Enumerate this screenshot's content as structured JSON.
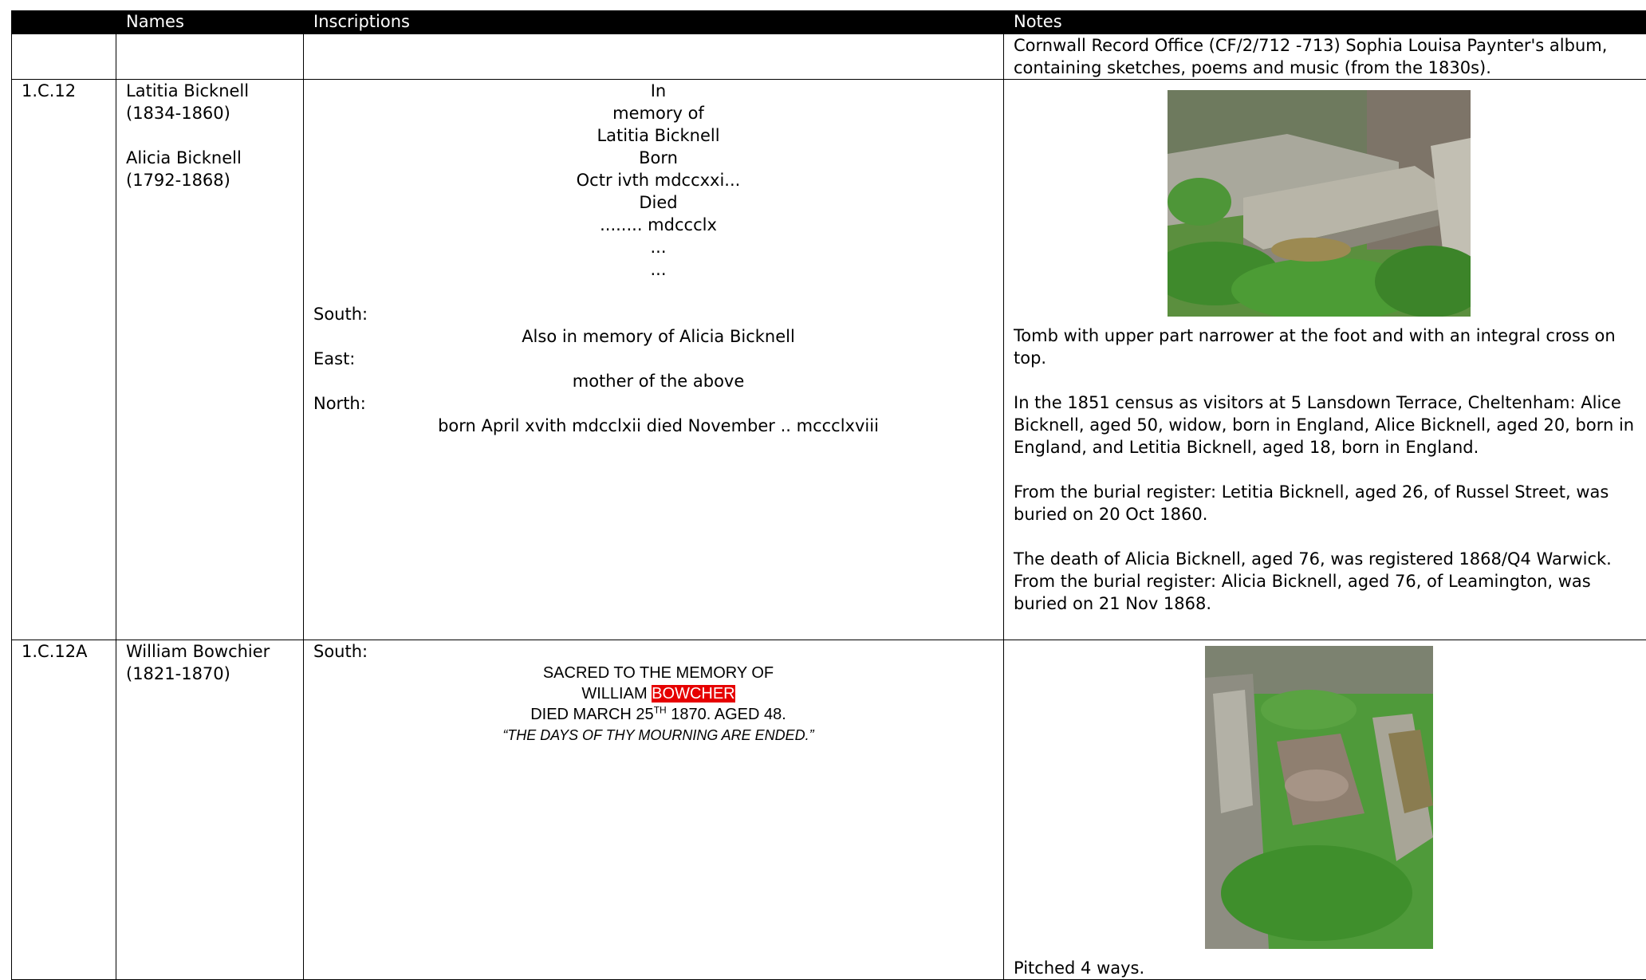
{
  "headers": [
    "",
    "Names",
    "Inscriptions",
    "Notes"
  ],
  "row0": {
    "note": "Cornwall Record Office (CF/2/712 -713) Sophia Louisa Paynter's album, containing sketches, poems and music (from the 1830s)."
  },
  "row1": {
    "id": "1.C.12",
    "name1": "Latitia Bicknell",
    "dates1": "(1834-1860)",
    "name2": "Alicia Bicknell",
    "dates2": "(1792-1868)",
    "inscription_lines": [
      "In",
      "memory of",
      "Latitia Bicknell",
      "Born",
      "Octr ivth mdccxxi...",
      "Died",
      "........ mdccclx",
      "...",
      "..."
    ],
    "south_label": "South:",
    "south_text": "Also in memory of Alicia Bicknell",
    "east_label": "East:",
    "east_text": "mother of the above",
    "north_label": "North:",
    "north_text": "born April xvith mdcclxii died November .. mccclxviii",
    "notes": [
      "Tomb with upper part narrower at the foot and with an integral cross on top.",
      "In the 1851 census as visitors at 5 Lansdown Terrace, Cheltenham: Alice Bicknell, aged 50, widow, born in England, Alice Bicknell, aged 20, born in England, and Letitia Bicknell, aged 18, born in England.",
      "From the burial register: Letitia Bicknell, aged 26, of Russel Street, was buried on 20 Oct 1860.",
      "The death of Alicia Bicknell, aged 76, was registered 1868/Q4 Warwick. From the burial register: Alicia Bicknell, aged 76, of Leamington, was buried on 21 Nov 1868."
    ]
  },
  "row2": {
    "id": "1.C.12A",
    "name": "William Bowchier",
    "dates": "(1821-1870)",
    "south_label": "South:",
    "line1": "SACRED TO THE MEMORY OF",
    "line2_a": "WILLIAM ",
    "line2_hl": "BOWCHER",
    "line3_a": "DIED MARCH 25",
    "line3_sup": "TH",
    "line3_b": " 1870. AGED 48.",
    "line4": "“THE DAYS OF THY MOURNING ARE ENDED.”",
    "note": "Pitched 4 ways."
  },
  "colors": {
    "header_bg": "#000000",
    "highlight": "#e60000",
    "ivy": "#4f9a3a",
    "stone": "#9a9a8e"
  }
}
